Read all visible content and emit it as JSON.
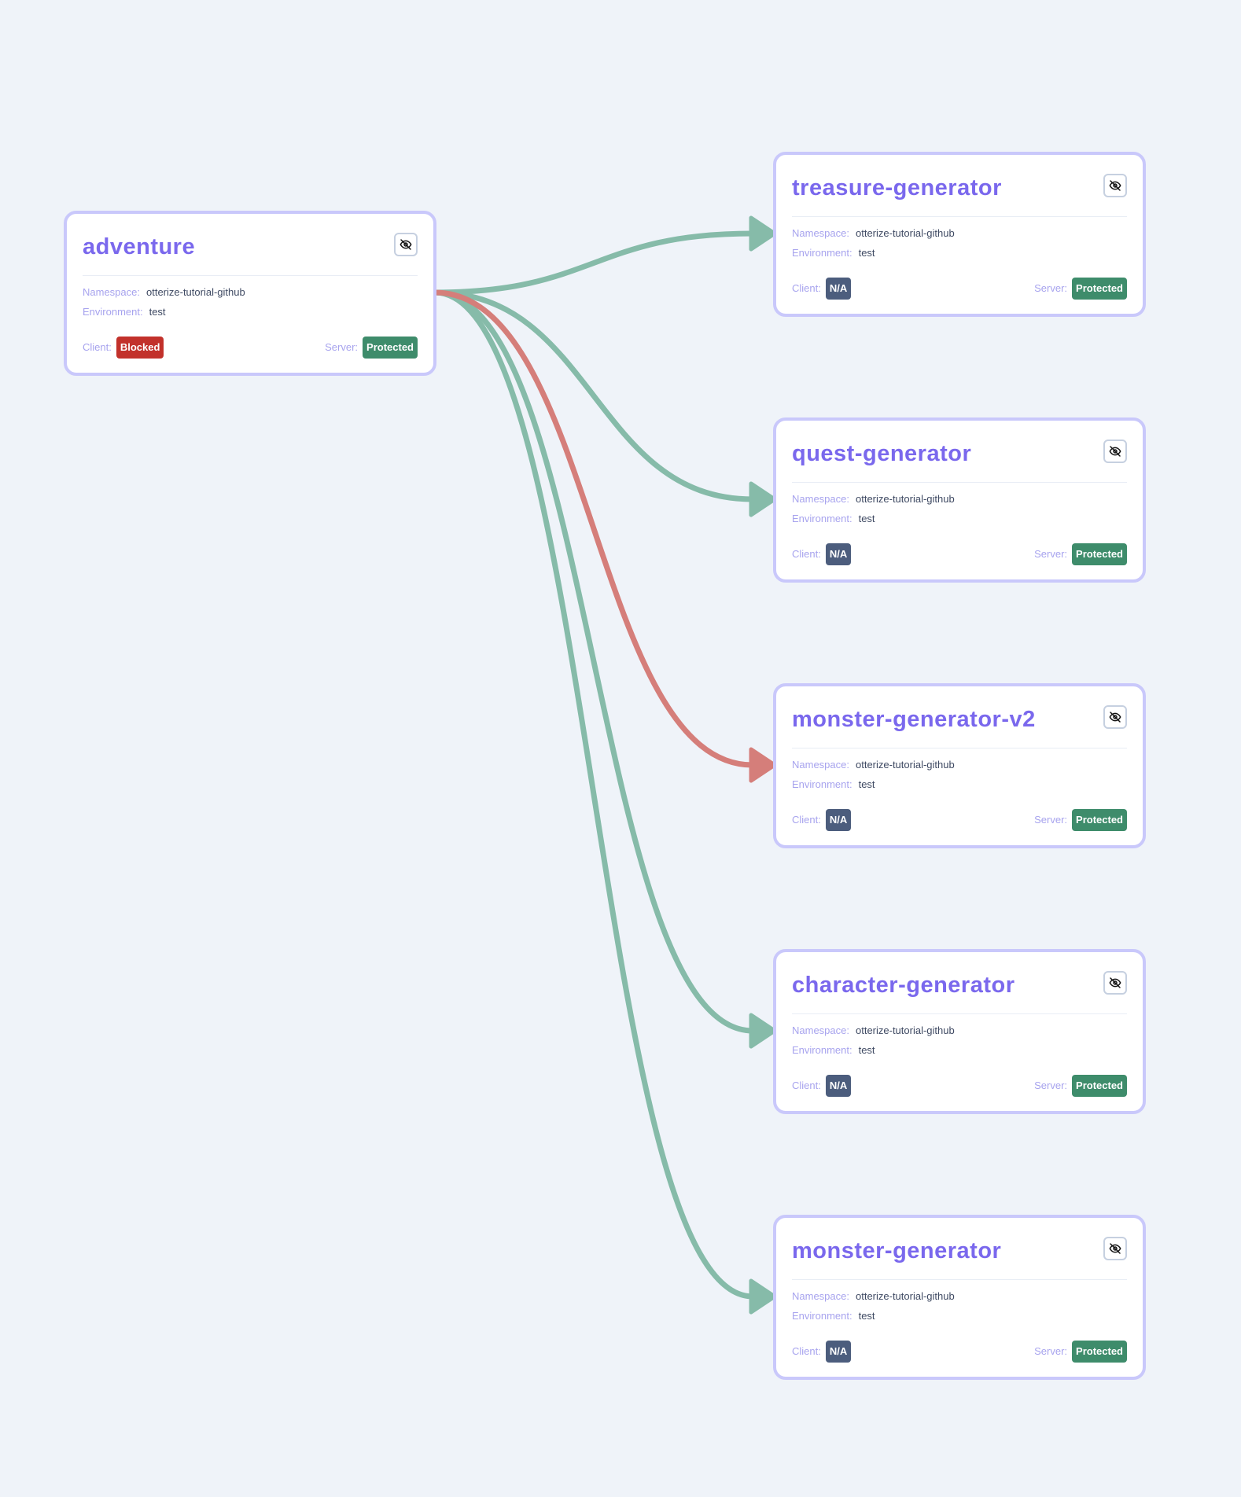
{
  "colors": {
    "allowed_edge": "#86bba9",
    "blocked_edge": "#d57e7a",
    "Blocked": "#c2312b",
    "Protected": "#3e8c6b",
    "N/A": "#4c5d7d"
  },
  "labels": {
    "namespace": "Namespace:",
    "environment": "Environment:",
    "client": "Client:",
    "server": "Server:"
  },
  "nodes": [
    {
      "id": "adventure",
      "name": "adventure",
      "namespace": "otterize-tutorial-github",
      "environment": "test",
      "client": "Blocked",
      "server": "Protected",
      "icon": "eye-off-icon"
    },
    {
      "id": "treasure-generator",
      "name": "treasure-generator",
      "namespace": "otterize-tutorial-github",
      "environment": "test",
      "client": "N/A",
      "server": "Protected",
      "icon": "eye-off-icon"
    },
    {
      "id": "quest-generator",
      "name": "quest-generator",
      "namespace": "otterize-tutorial-github",
      "environment": "test",
      "client": "N/A",
      "server": "Protected",
      "icon": "eye-off-icon"
    },
    {
      "id": "monster-generator-v2",
      "name": "monster-generator-v2",
      "namespace": "otterize-tutorial-github",
      "environment": "test",
      "client": "N/A",
      "server": "Protected",
      "icon": "eye-off-icon"
    },
    {
      "id": "character-generator",
      "name": "character-generator",
      "namespace": "otterize-tutorial-github",
      "environment": "test",
      "client": "N/A",
      "server": "Protected",
      "icon": "eye-off-icon"
    },
    {
      "id": "monster-generator",
      "name": "monster-generator",
      "namespace": "otterize-tutorial-github",
      "environment": "test",
      "client": "N/A",
      "server": "Protected",
      "icon": "eye-off-icon"
    }
  ],
  "edges": [
    {
      "from": "adventure",
      "to": "treasure-generator",
      "status": "allowed"
    },
    {
      "from": "adventure",
      "to": "quest-generator",
      "status": "allowed"
    },
    {
      "from": "adventure",
      "to": "monster-generator-v2",
      "status": "blocked"
    },
    {
      "from": "adventure",
      "to": "character-generator",
      "status": "allowed"
    },
    {
      "from": "adventure",
      "to": "monster-generator",
      "status": "allowed"
    }
  ]
}
